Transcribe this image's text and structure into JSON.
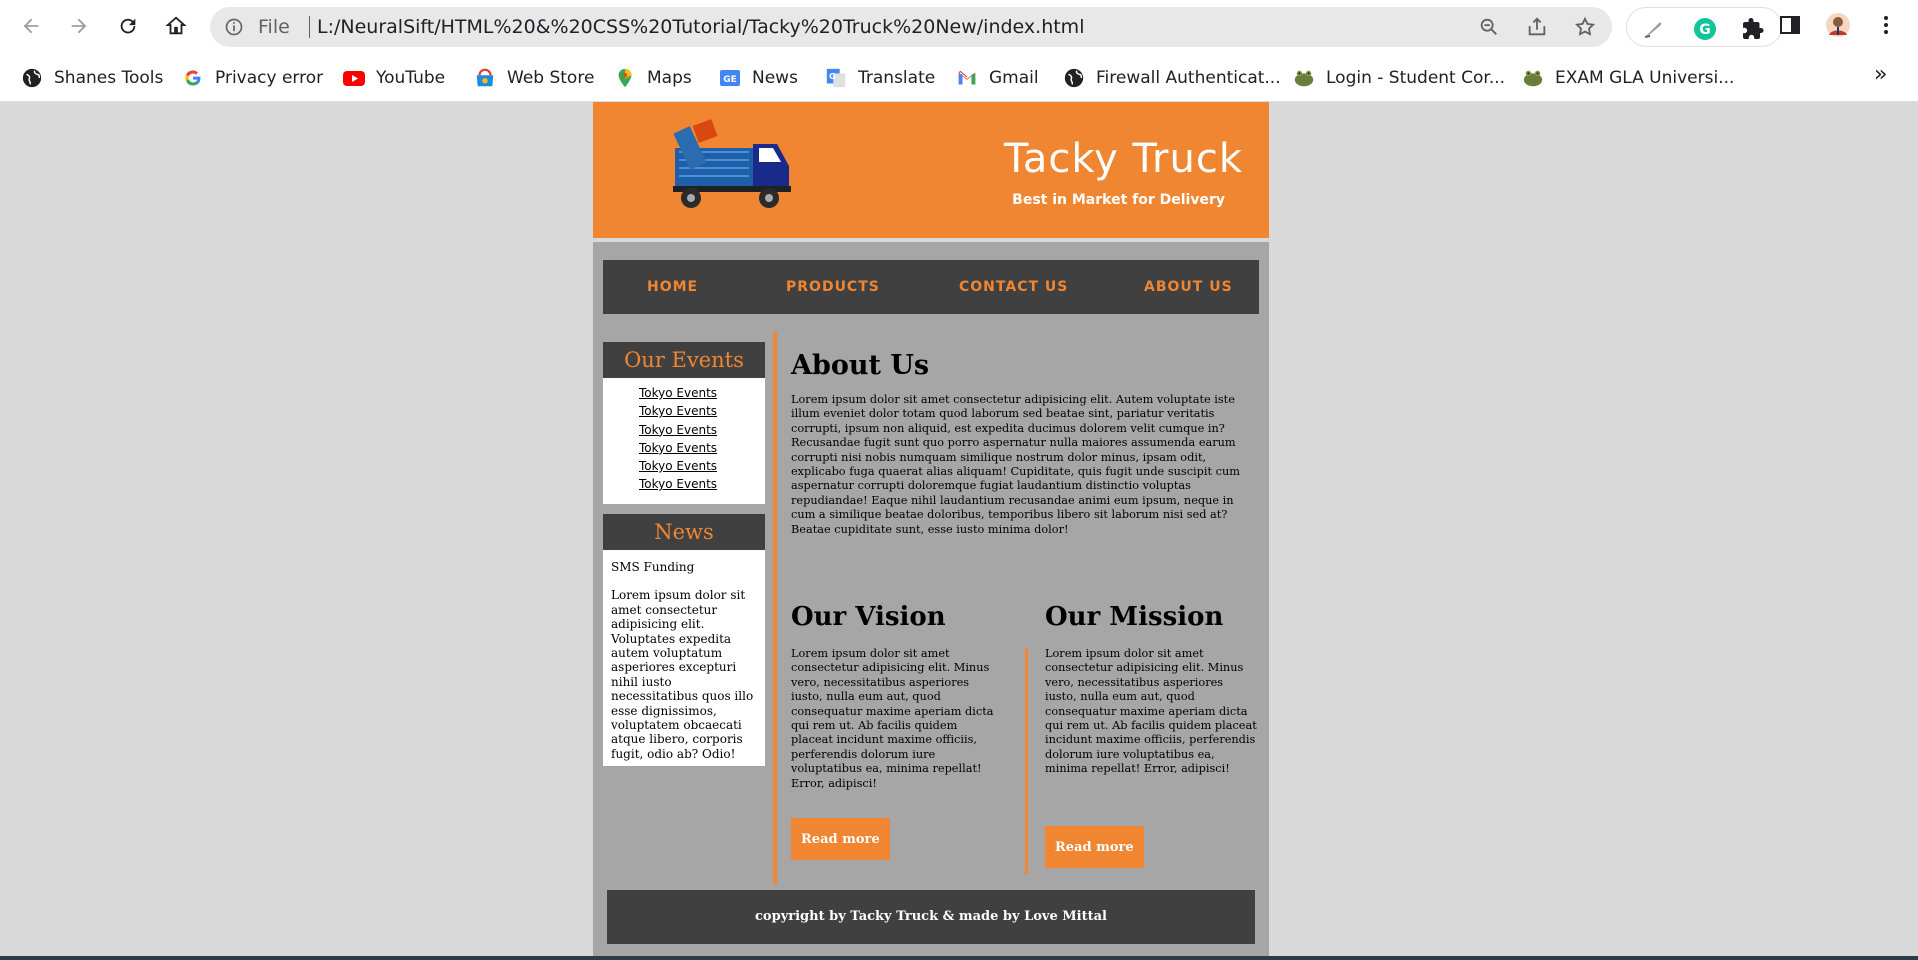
{
  "browser": {
    "file_label": "File",
    "url": "L:/NeuralSift/HTML%20&%20CSS%20Tutorial/Tacky%20Truck%20New/index.html",
    "nav_icons": [
      "back-arrow-icon",
      "forward-arrow-icon",
      "reload-icon",
      "home-icon"
    ],
    "bookmarks": [
      {
        "label": "Shanes Tools",
        "icon": "globe-icon"
      },
      {
        "label": "Privacy error",
        "icon": "google-icon"
      },
      {
        "label": "YouTube",
        "icon": "youtube-icon"
      },
      {
        "label": "Web Store",
        "icon": "web-store-icon"
      },
      {
        "label": "Maps",
        "icon": "maps-icon"
      },
      {
        "label": "News",
        "icon": "news-icon"
      },
      {
        "label": "Translate",
        "icon": "translate-icon"
      },
      {
        "label": "Gmail",
        "icon": "gmail-icon"
      },
      {
        "label": "Firewall Authenticat...",
        "icon": "globe-icon"
      },
      {
        "label": "Login - Student Cor...",
        "icon": "frog-icon"
      },
      {
        "label": "EXAM GLA Universi...",
        "icon": "frog-icon"
      }
    ],
    "more_label": "»"
  },
  "site": {
    "title": "Tacky Truck",
    "tagline": "Best in Market for Delivery",
    "nav": [
      "HOME",
      "PRODUCTS",
      "CONTACT US",
      "ABOUT US"
    ],
    "events": {
      "heading": "Our Events",
      "items": [
        "Tokyo Events",
        "Tokyo Events",
        "Tokyo Events",
        "Tokyo Events",
        "Tokyo Events",
        "Tokyo Events"
      ]
    },
    "news": {
      "heading": "News",
      "item_title": "SMS Funding",
      "item_text": "Lorem ipsum dolor sit amet consectetur adipisicing elit. Voluptates expedita autem voluptatum asperiores excepturi nihil iusto necessitatibus quos illo esse dignissimos, voluptatem obcaecati atque libero, corporis fugit, odio ab? Odio!"
    },
    "about": {
      "title": "About Us",
      "text": "Lorem ipsum dolor sit amet consectetur adipisicing elit. Autem voluptate iste illum eveniet dolor totam quod laborum sed beatae sint, pariatur veritatis corrupti, ipsum non aliquid, est expedita ducimus dolorem velit cumque in? Recusandae fugit sunt quo porro aspernatur nulla maiores assumenda earum corrupti nisi nobis numquam similique nostrum dolor minus, ipsam odit, explicabo fuga quaerat alias aliquam! Cupiditate, quis fugit unde suscipit cum aspernatur corrupti doloremque fugiat laudantium distinctio voluptas repudiandae! Eaque nihil laudantium recusandae animi eum ipsum, neque in cum a similique beatae doloribus, temporibus libero sit laborum nisi sed at? Beatae cupiditate sunt, esse iusto minima dolor!"
    },
    "vision": {
      "title": "Our Vision",
      "text": "Lorem ipsum dolor sit amet consectetur adipisicing elit. Minus vero, necessitatibus asperiores iusto, nulla eum aut, quod consequatur maxime aperiam dicta qui rem ut. Ab facilis quidem placeat incidunt maxime officiis, perferendis dolorum iure voluptatibus ea, minima repellat! Error, adipisci!",
      "button": "Read more"
    },
    "mission": {
      "title": "Our Mission",
      "text": "Lorem ipsum dolor sit amet consectetur adipisicing elit. Minus vero, necessitatibus asperiores iusto, nulla eum aut, quod consequatur maxime aperiam dicta qui rem ut. Ab facilis quidem placeat incidunt maxime officiis, perferendis dolorum iure voluptatibus ea, minima repellat! Error, adipisci!",
      "button": "Read more"
    },
    "footer": "copyright by Tacky Truck & made by Love Mittal"
  },
  "colors": {
    "brand_orange": "#f08632",
    "dark_gray": "#404040",
    "page_gray": "#a6a6a6"
  }
}
